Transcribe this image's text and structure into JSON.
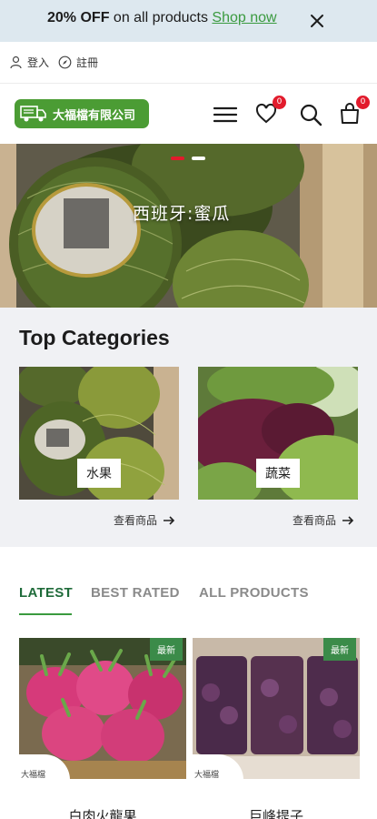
{
  "promo": {
    "discount": "20% OFF",
    "text": " on all products ",
    "link": "Shop now"
  },
  "account": {
    "login": "登入",
    "register": "註冊"
  },
  "header": {
    "logo_text": "大福檔有限公司",
    "wishlist_count": "0",
    "cart_count": "0"
  },
  "hero": {
    "caption": "西班牙:蜜瓜",
    "slides": 2,
    "active_slide": 1
  },
  "categories": {
    "title": "Top Categories",
    "items": [
      {
        "label": "水果",
        "link": "查看商品"
      },
      {
        "label": "蔬菜",
        "link": "查看商品"
      }
    ]
  },
  "tabs": [
    {
      "label": "LATEST",
      "active": true
    },
    {
      "label": "BEST RATED",
      "active": false
    },
    {
      "label": "ALL PRODUCTS",
      "active": false
    }
  ],
  "products": [
    {
      "badge": "最新",
      "vendor": "大福檔",
      "name": "白肉火龍果"
    },
    {
      "badge": "最新",
      "vendor": "大福檔",
      "name": "巨峰提子"
    }
  ],
  "colors": {
    "brand_green": "#4b9c34",
    "accent_green": "#3a9a3f",
    "badge_red": "#e21b2c",
    "promo_bg": "#dde8ef"
  }
}
